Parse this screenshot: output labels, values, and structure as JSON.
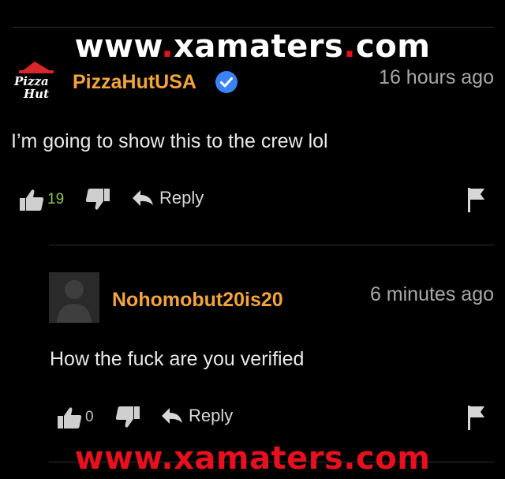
{
  "watermark": {
    "top": {
      "prefix": "www",
      "dot1": ".",
      "middle": "xamaters",
      "dot2": ".",
      "suffix": "com"
    },
    "bottom": "www.xamaters.com"
  },
  "comments": [
    {
      "username": "PizzaHutUSA",
      "logo_text": [
        "Pizza",
        "Hut"
      ],
      "verified": true,
      "time": "16 hours ago",
      "text": "I’m going to show this to the crew lol",
      "likes": "19",
      "reply_label": "Reply"
    },
    {
      "username": "Nohomobut20is20",
      "time": "6 minutes ago",
      "text": "How the fuck are you verified",
      "likes": "0",
      "reply_label": "Reply"
    }
  ],
  "colors": {
    "background": "#000000",
    "username": "#f3a43d",
    "watermark_accent": "#e8101e",
    "verified_badge": "#3b82f6",
    "likes_count_1": "#8ec25a",
    "likes_count_2": "#bdbdbd"
  }
}
